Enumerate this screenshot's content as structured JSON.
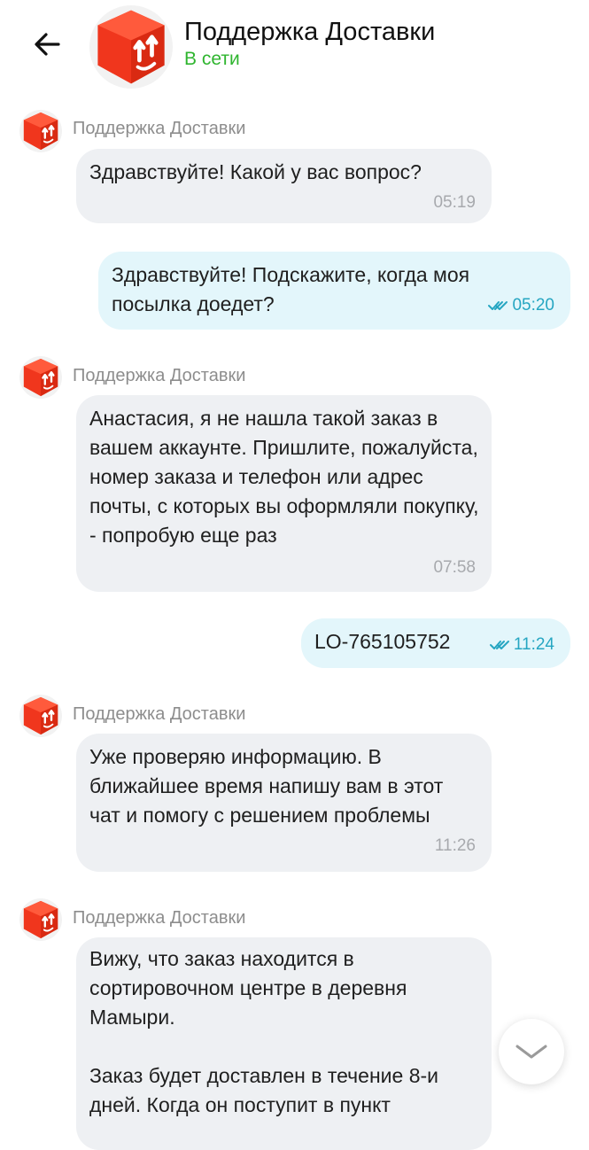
{
  "header": {
    "title": "Поддержка Доставки",
    "status": "В сети"
  },
  "colors": {
    "brand": "#f0361d",
    "online": "#2fb52f",
    "incoming_bubble": "#eef0f3",
    "outgoing_bubble": "#e3f6fb",
    "read_ticks": "#26a6c2"
  },
  "icons": {
    "back": "arrow-left-icon",
    "avatar": "box-logo-icon",
    "scroll": "chevron-down-icon",
    "read": "double-check-icon"
  },
  "messages": [
    {
      "sender": "Поддержка Доставки",
      "text": "Здравствуйте! Какой у вас вопрос?",
      "time": "05:19"
    },
    {
      "text": "Здравствуйте! Подскажите, когда моя посылка доедет?",
      "time": "05:20"
    },
    {
      "sender": "Поддержка Доставки",
      "text": "Анастасия, я не нашла такой заказ в вашем аккаунте. Пришлите, пожалуйста, номер заказа и телефон или адрес почты, с которых вы оформляли покупку, - попробую еще раз",
      "time": "07:58"
    },
    {
      "text": "LO-765105752",
      "time": "11:24"
    },
    {
      "sender": "Поддержка Доставки",
      "text": "Уже проверяю информацию. В ближайшее время напишу вам в этот чат и помогу с решением проблемы",
      "time": "11:26"
    },
    {
      "sender": "Поддержка Доставки",
      "text": "Вижу, что заказ находится в сортировочном центре в деревня Мамыри.\n\nЗаказ будет доставлен в течение 8-и дней. Когда он поступит в пункт"
    }
  ]
}
